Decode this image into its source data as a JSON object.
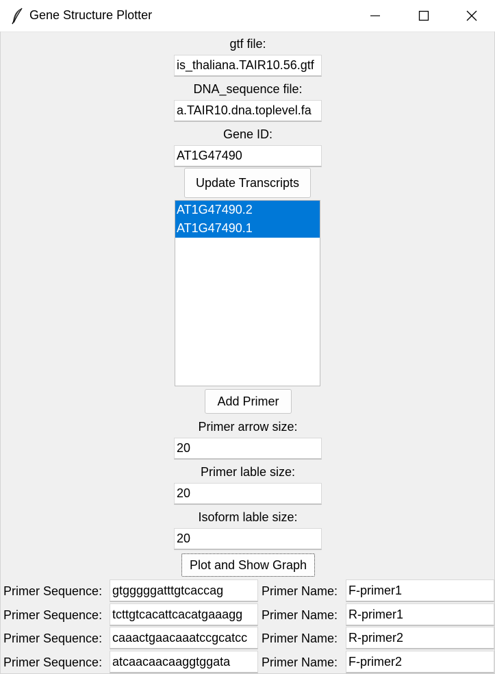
{
  "window": {
    "title": "Gene Structure Plotter",
    "app_icon": "feather-icon",
    "controls": [
      "minimize-icon",
      "maximize-icon",
      "close-icon"
    ]
  },
  "form": {
    "gtf_label": "gtf file:",
    "gtf_value": "is_thaliana.TAIR10.56.gtf",
    "dna_label": "DNA_sequence file:",
    "dna_value": "a.TAIR10.dna.toplevel.fa",
    "gene_label": "Gene ID:",
    "gene_value": "AT1G47490",
    "update_button": "Update Transcripts",
    "transcripts": [
      "AT1G47490.2",
      "AT1G47490.1"
    ],
    "add_primer_button": "Add Primer",
    "arrow_size_label": "Primer arrow size:",
    "arrow_size_value": "20",
    "primer_label_size_label": "Primer lable size:",
    "primer_label_size_value": "20",
    "isoform_label_size_label": "Isoform lable size:",
    "isoform_label_size_value": "20",
    "plot_button": "Plot and Show Graph"
  },
  "primers": [
    {
      "seq_label": "Primer Sequence:",
      "sequence": "gtgggggatttgtcaccag",
      "name_label": "Primer Name:",
      "name": "F-primer1"
    },
    {
      "seq_label": "Primer Sequence:",
      "sequence": "tcttgtcacattcacatgaaagg",
      "name_label": "Primer Name:",
      "name": "R-primer1"
    },
    {
      "seq_label": "Primer Sequence:",
      "sequence": "caaactgaacaaatccgcatcc",
      "name_label": "Primer Name:",
      "name": "R-primer2"
    },
    {
      "seq_label": "Primer Sequence:",
      "sequence": "atcaacaacaaggtggata",
      "name_label": "Primer Name:",
      "name": "F-primer2"
    }
  ],
  "colors": {
    "background": "#f0f0f0",
    "selection": "#0078d7",
    "titlebar": "#ffffff"
  }
}
